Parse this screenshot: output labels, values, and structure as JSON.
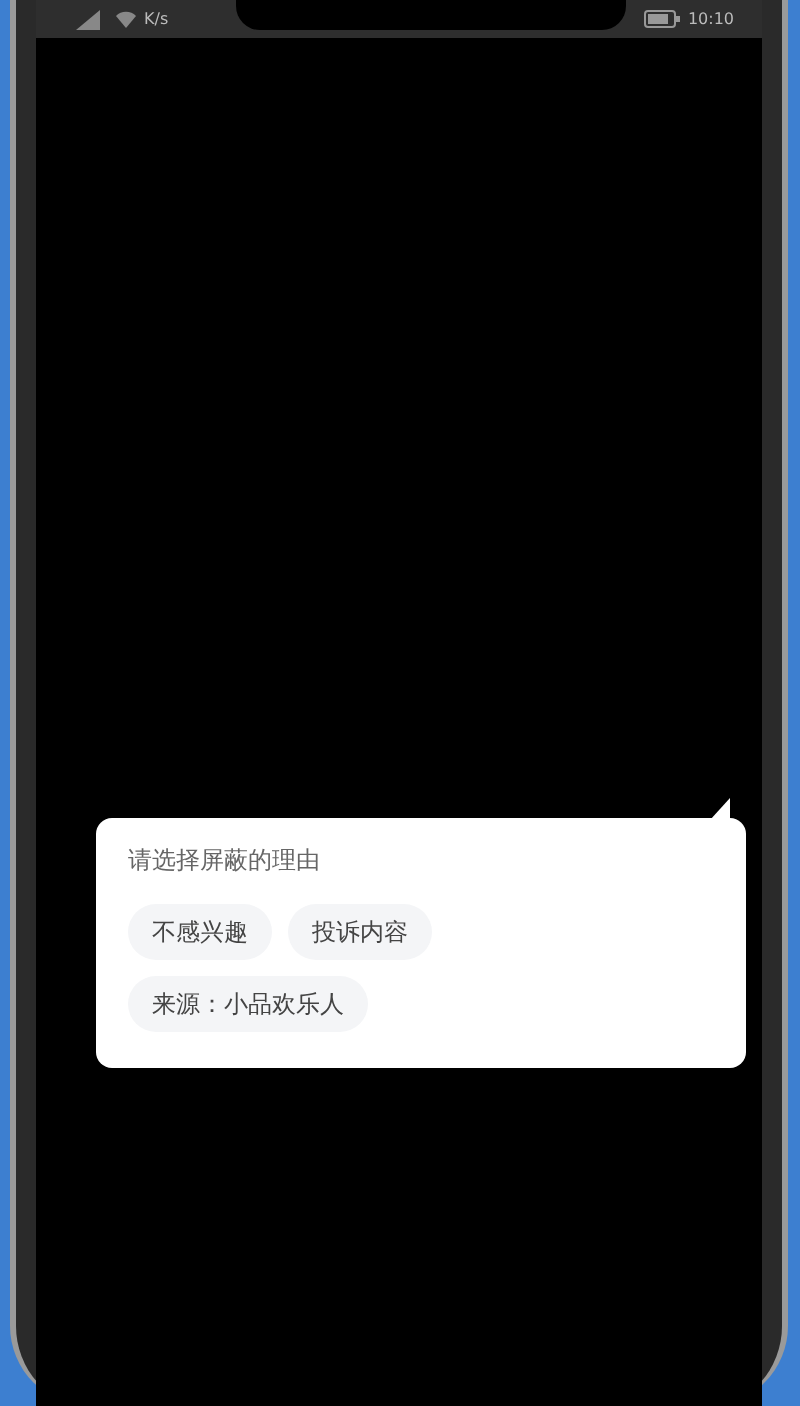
{
  "status_bar": {
    "speed": "K/s",
    "time": "10:10"
  },
  "popup": {
    "title": "请选择屏蔽的理由",
    "options": [
      {
        "label": "不感兴趣"
      },
      {
        "label": "投诉内容"
      },
      {
        "label": "来源：小品欢乐人"
      }
    ]
  }
}
